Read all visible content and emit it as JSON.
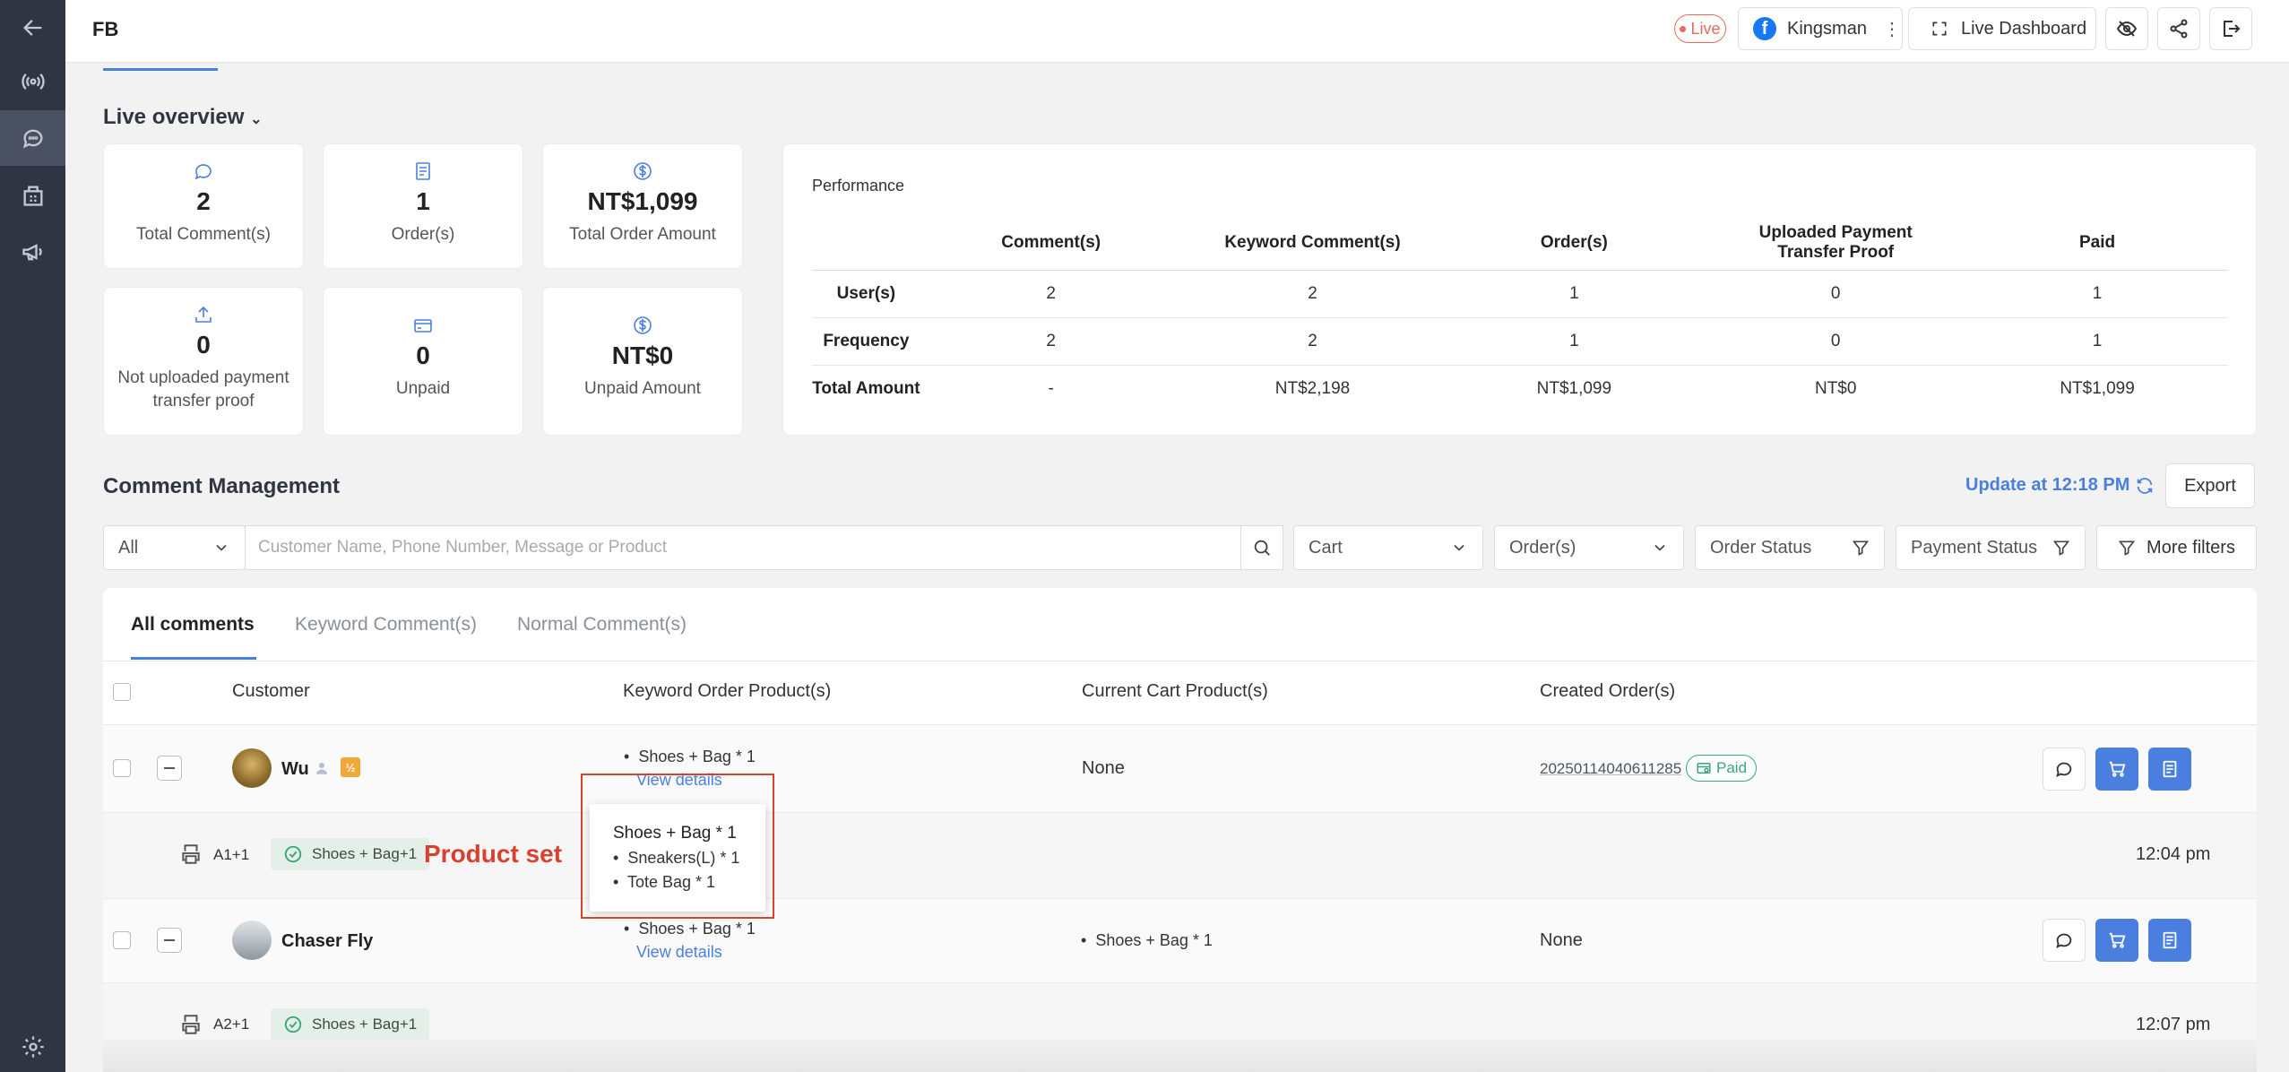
{
  "topbar": {
    "title": "FB",
    "live_label": "Live",
    "page_name": "Kingsman",
    "dashboard_label": "Live Dashboard"
  },
  "overview": {
    "title": "Live overview",
    "cards": [
      {
        "value": "2",
        "label": "Total Comment(s)",
        "icon": "comment-icon"
      },
      {
        "value": "1",
        "label": "Order(s)",
        "icon": "receipt-icon"
      },
      {
        "value": "NT$1,099",
        "label": "Total Order Amount",
        "icon": "dollar-icon"
      },
      {
        "value": "0",
        "label": "Not uploaded payment transfer proof",
        "icon": "upload-icon"
      },
      {
        "value": "0",
        "label": "Unpaid",
        "icon": "card-icon"
      },
      {
        "value": "NT$0",
        "label": "Unpaid Amount",
        "icon": "dollar-icon"
      }
    ]
  },
  "performance": {
    "title": "Performance",
    "columns": [
      "Comment(s)",
      "Keyword Comment(s)",
      "Order(s)",
      "Uploaded Payment Transfer Proof",
      "Paid"
    ],
    "rows": [
      {
        "label": "User(s)",
        "values": [
          "2",
          "2",
          "1",
          "0",
          "1"
        ]
      },
      {
        "label": "Frequency",
        "values": [
          "2",
          "2",
          "1",
          "0",
          "1"
        ]
      },
      {
        "label": "Total Amount",
        "values": [
          "-",
          "NT$2,198",
          "NT$1,099",
          "NT$0",
          "NT$1,099"
        ]
      }
    ]
  },
  "comment_management": {
    "title": "Comment Management",
    "update_label": "Update at 12:18 PM",
    "export_label": "Export",
    "filters": {
      "scope": "All",
      "search_placeholder": "Customer Name, Phone Number, Message or Product",
      "cart": "Cart",
      "orders": "Order(s)",
      "order_status": "Order Status",
      "payment_status": "Payment Status",
      "more_filters": "More filters"
    },
    "tabs": [
      "All comments",
      "Keyword Comment(s)",
      "Normal Comment(s)"
    ],
    "headers": [
      "Customer",
      "Keyword Order Product(s)",
      "Current Cart Product(s)",
      "Created Order(s)"
    ],
    "rows": [
      {
        "customer": "Wu",
        "keyword_product": "Shoes + Bag  * 1",
        "view_details": "View details",
        "cart": "None",
        "order_no": "20250114040611285",
        "order_status": "Paid",
        "comment_code": "A1+1",
        "keyword_tag": "Shoes + Bag+1",
        "time": "12:04 pm"
      },
      {
        "customer": "Chaser Fly",
        "keyword_product": "Shoes + Bag  * 1",
        "view_details": "View details",
        "cart": "Shoes + Bag  * 1",
        "order_no": "None",
        "comment_code": "A2+1",
        "keyword_tag": "Shoes + Bag+1",
        "time": "12:07 pm"
      }
    ],
    "popover": {
      "title": "Shoes + Bag  * 1",
      "items": [
        "Sneakers(L) * 1",
        "Tote Bag * 1"
      ]
    },
    "annotation": "Product set"
  },
  "colors": {
    "accent": "#4a7fe0",
    "live": "#e36b5c",
    "paid": "#3aa57a",
    "annotation": "#d9412e",
    "sidebar": "#2f3542"
  }
}
